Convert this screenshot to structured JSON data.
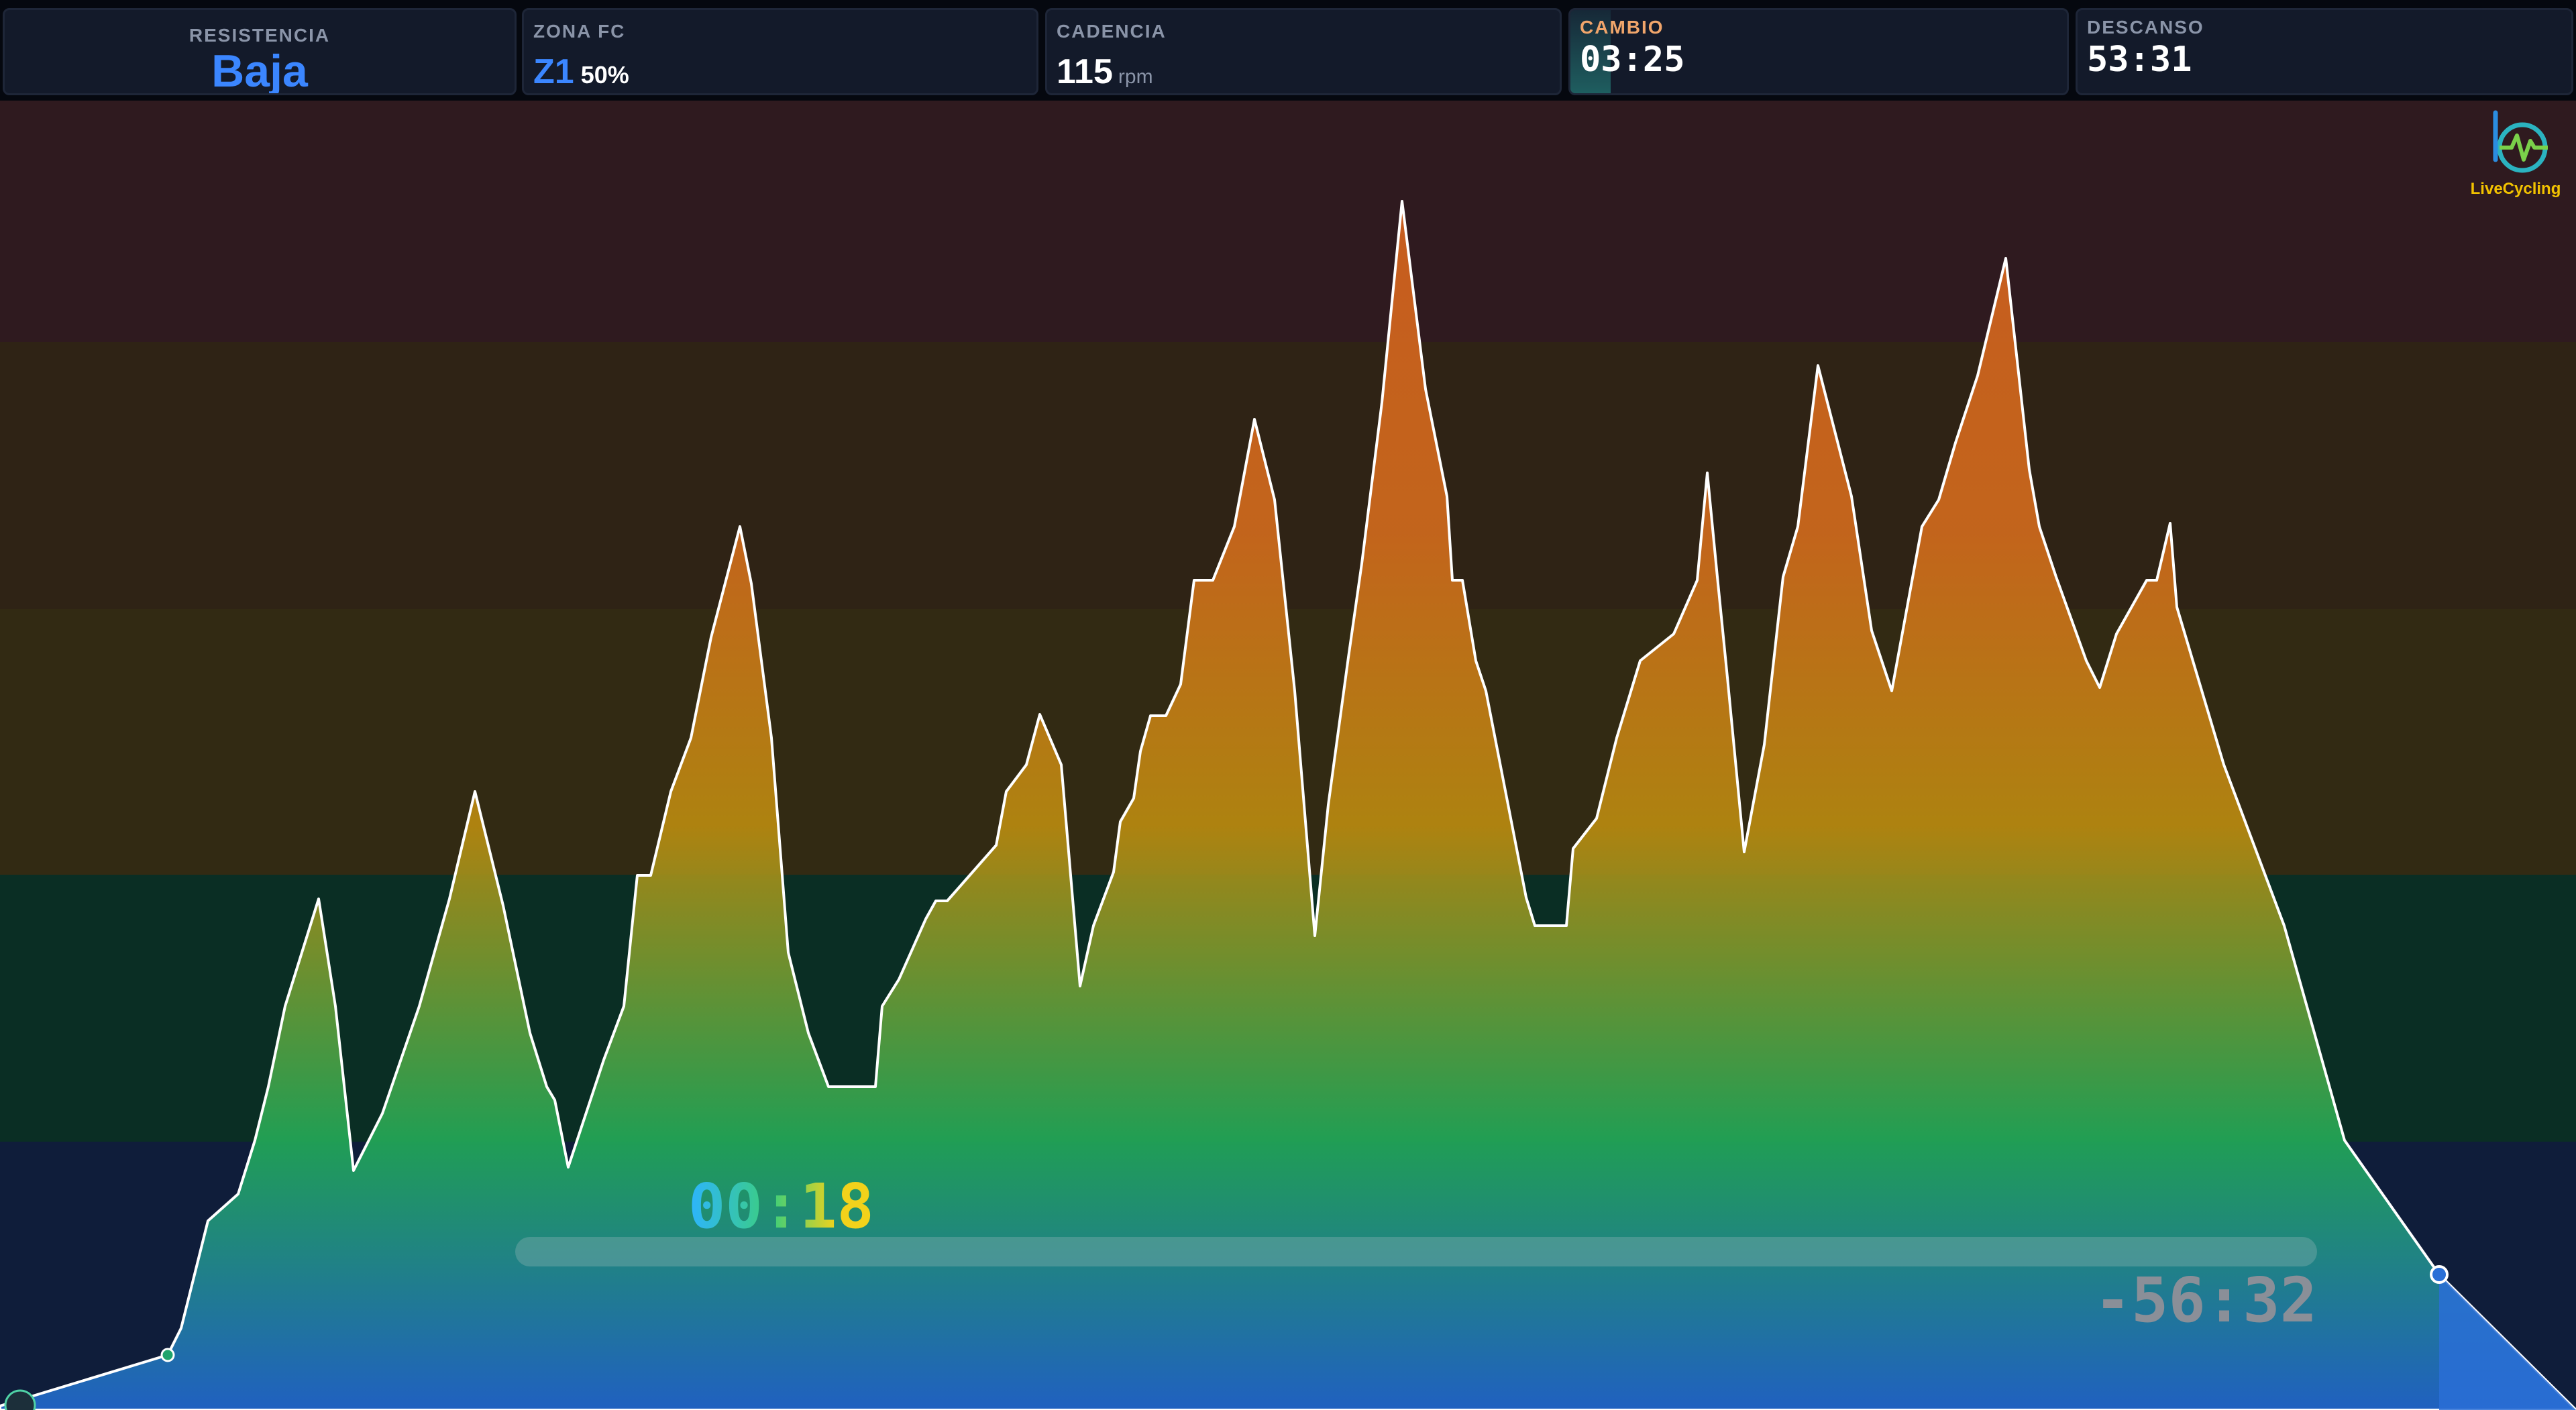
{
  "metrics": {
    "resistencia": {
      "label": "RESISTENCIA",
      "value": "Baja"
    },
    "zona_fc": {
      "label": "ZONA FC",
      "zone": "Z1",
      "percent": "50%"
    },
    "cadencia": {
      "label": "CADENCIA",
      "value": "115",
      "unit": "rpm"
    },
    "cambio": {
      "label": "CAMBIO",
      "time": "03:25"
    },
    "descanso": {
      "label": "DESCANSO",
      "time": "53:31"
    }
  },
  "logo": {
    "text": "LiveCycling"
  },
  "timer": {
    "elapsed": "00:18",
    "remaining": "-56:32"
  },
  "colors": {
    "accent_blue": "#3b86ff",
    "cambio_label": "#f0a56b",
    "zone_bands": [
      "#0f1d3a",
      "#0a2e24",
      "#322a13",
      "#2f2315",
      "#2f1a1f"
    ],
    "profile_gradient": [
      "#2266cc",
      "#22a858",
      "#b88a10",
      "#d4621f"
    ]
  }
}
